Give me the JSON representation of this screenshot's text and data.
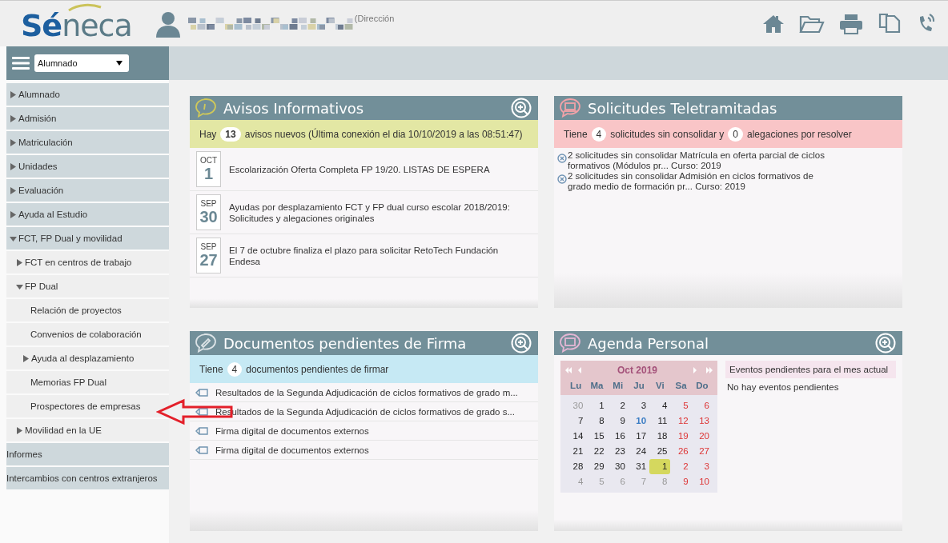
{
  "header": {
    "logo": "Séneca",
    "user_role": "(Dirección"
  },
  "sidebar": {
    "selector": {
      "value": "Alumnado"
    },
    "items": [
      {
        "label": "Alumnado",
        "kind": "folder",
        "expanded": false
      },
      {
        "label": "Admisión",
        "kind": "folder",
        "expanded": false
      },
      {
        "label": "Matriculación",
        "kind": "folder",
        "expanded": false
      },
      {
        "label": "Unidades",
        "kind": "folder",
        "expanded": false
      },
      {
        "label": "Evaluación",
        "kind": "folder",
        "expanded": false
      },
      {
        "label": "Ayuda al Estudio",
        "kind": "folder",
        "expanded": false
      },
      {
        "label": "FCT, FP Dual y movilidad",
        "kind": "folder",
        "expanded": true,
        "children": [
          {
            "label": "FCT en centros de trabajo",
            "kind": "folder",
            "expanded": false
          },
          {
            "label": "FP Dual",
            "kind": "folder",
            "expanded": true,
            "children": [
              {
                "label": "Relación de proyectos",
                "kind": "link"
              },
              {
                "label": "Convenios de colaboración",
                "kind": "link"
              },
              {
                "label": "Ayuda al desplazamiento",
                "kind": "folder",
                "expanded": false
              },
              {
                "label": "Memorias FP Dual",
                "kind": "link"
              },
              {
                "label": "Prospectores de empresas",
                "kind": "link"
              }
            ]
          },
          {
            "label": "Movilidad en la UE",
            "kind": "folder",
            "expanded": false
          }
        ]
      },
      {
        "label": "Informes",
        "kind": "link"
      },
      {
        "label": "Intercambios con centros extranjeros",
        "kind": "link"
      }
    ]
  },
  "avisos": {
    "title": "Avisos Informativos",
    "summary": {
      "prefix": "Hay",
      "count": "13",
      "suffix": "avisos nuevos (Última conexión el dia 10/10/2019 a las 08:51:47)"
    },
    "items": [
      {
        "month": "OCT",
        "day": "1",
        "text": "Escolarización Oferta Completa FP 19/20. LISTAS DE ESPERA"
      },
      {
        "month": "SEP",
        "day": "30",
        "text": "Ayudas por desplazamiento FCT y FP dual curso escolar 2018/2019: Solicitudes y alegaciones originales"
      },
      {
        "month": "SEP",
        "day": "27",
        "text": "El 7 de octubre finaliza el plazo para solicitar RetoTech Fundación Endesa"
      }
    ]
  },
  "solicitudes": {
    "title": "Solicitudes Teletramitadas",
    "summary": {
      "prefix": "Tiene",
      "count_1": "4",
      "middle": "solicitudes sin consolidar y",
      "count_2": "0",
      "suffix": "alegaciones por resolver"
    },
    "items": [
      "2 solicitudes sin consolidar Matrícula en oferta parcial de ciclos formativos (Módulos pr... Curso: 2019",
      "2 solicitudes sin consolidar Admisión en ciclos formativos de grado medio de formación pr... Curso: 2019"
    ]
  },
  "documentos": {
    "title": "Documentos pendientes de Firma",
    "summary": {
      "prefix": "Tiene",
      "count": "4",
      "suffix": "documentos pendientes de firmar"
    },
    "items": [
      "Resultados de la Segunda Adjudicación de ciclos formativos de grado m...",
      "Resultados de la Segunda Adjudicación de ciclos formativos de grado s...",
      "Firma digital de documentos externos",
      "Firma digital de documentos externos"
    ]
  },
  "agenda": {
    "title": "Agenda Personal",
    "calendar": {
      "month": "Oct 2019",
      "weekdays": [
        "Lu",
        "Ma",
        "Mi",
        "Ju",
        "Vi",
        "Sa",
        "Do"
      ],
      "weeks": [
        [
          {
            "d": "30",
            "kind": "other",
            "selected": false
          },
          {
            "d": "1",
            "kind": "normal",
            "selected": false
          },
          {
            "d": "2",
            "kind": "normal",
            "selected": false
          },
          {
            "d": "3",
            "kind": "normal",
            "selected": false
          },
          {
            "d": "4",
            "kind": "normal",
            "selected": false
          },
          {
            "d": "5",
            "kind": "weekend",
            "selected": false
          },
          {
            "d": "6",
            "kind": "weekend",
            "selected": false
          }
        ],
        [
          {
            "d": "7",
            "kind": "normal",
            "selected": false
          },
          {
            "d": "8",
            "kind": "normal",
            "selected": false
          },
          {
            "d": "9",
            "kind": "normal",
            "selected": false
          },
          {
            "d": "10",
            "kind": "today",
            "selected": false
          },
          {
            "d": "11",
            "kind": "normal",
            "selected": false
          },
          {
            "d": "12",
            "kind": "weekend",
            "selected": false
          },
          {
            "d": "13",
            "kind": "weekend",
            "selected": false
          }
        ],
        [
          {
            "d": "14",
            "kind": "normal",
            "selected": false
          },
          {
            "d": "15",
            "kind": "normal",
            "selected": false
          },
          {
            "d": "16",
            "kind": "normal",
            "selected": false
          },
          {
            "d": "17",
            "kind": "normal",
            "selected": false
          },
          {
            "d": "18",
            "kind": "normal",
            "selected": false
          },
          {
            "d": "19",
            "kind": "weekend",
            "selected": false
          },
          {
            "d": "20",
            "kind": "weekend",
            "selected": false
          }
        ],
        [
          {
            "d": "21",
            "kind": "normal",
            "selected": false
          },
          {
            "d": "22",
            "kind": "normal",
            "selected": false
          },
          {
            "d": "23",
            "kind": "normal",
            "selected": false
          },
          {
            "d": "24",
            "kind": "normal",
            "selected": false
          },
          {
            "d": "25",
            "kind": "normal",
            "selected": false
          },
          {
            "d": "26",
            "kind": "weekend",
            "selected": false
          },
          {
            "d": "27",
            "kind": "weekend",
            "selected": false
          }
        ],
        [
          {
            "d": "28",
            "kind": "normal",
            "selected": false
          },
          {
            "d": "29",
            "kind": "normal",
            "selected": false
          },
          {
            "d": "30",
            "kind": "normal",
            "selected": false
          },
          {
            "d": "31",
            "kind": "normal",
            "selected": false
          },
          {
            "d": "1",
            "kind": "other",
            "selected": true
          },
          {
            "d": "2",
            "kind": "weekend",
            "selected": false
          },
          {
            "d": "3",
            "kind": "weekend",
            "selected": false
          }
        ],
        [
          {
            "d": "4",
            "kind": "other",
            "selected": false
          },
          {
            "d": "5",
            "kind": "other",
            "selected": false
          },
          {
            "d": "6",
            "kind": "other",
            "selected": false
          },
          {
            "d": "7",
            "kind": "other",
            "selected": false
          },
          {
            "d": "8",
            "kind": "other",
            "selected": false
          },
          {
            "d": "9",
            "kind": "weekend",
            "selected": false
          },
          {
            "d": "10",
            "kind": "weekend",
            "selected": false
          }
        ]
      ]
    },
    "events_title": "Eventos pendientes para el mes actual",
    "events_empty": "No hay eventos pendientes"
  }
}
